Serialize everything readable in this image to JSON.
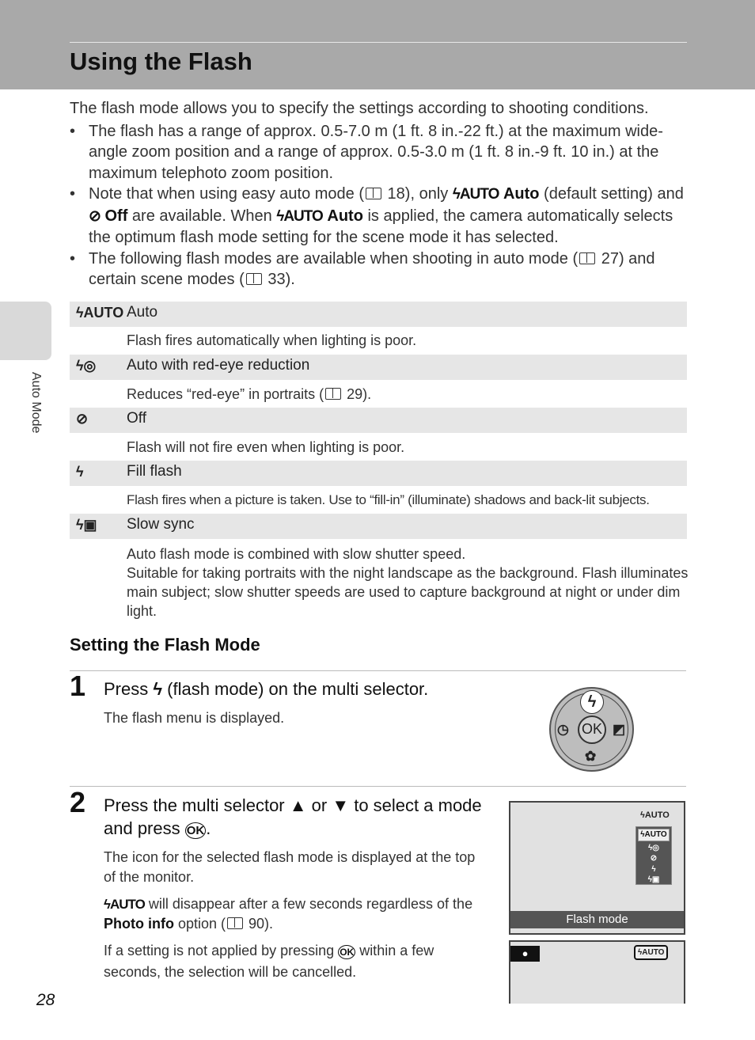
{
  "header": {
    "title": "Using the Flash"
  },
  "sidebar": {
    "section": "Auto Mode"
  },
  "intro": "The flash mode allows you to specify the settings according to shooting conditions.",
  "bullets": {
    "b1": "The flash has a range of approx. 0.5-7.0 m (1 ft. 8 in.-22 ft.) at the maximum wide-angle zoom position and a range of approx. 0.5-3.0 m (1 ft. 8 in.-9 ft. 10 in.) at the maximum telephoto zoom position.",
    "b2a": "Note that when using easy auto mode (",
    "b2b": " 18), only ",
    "b2auto": "Auto",
    "b2c": " (default setting) and ",
    "b2off": "Off",
    "b2d": " are available. When ",
    "b2e": " is applied, the camera automatically selects the optimum flash mode setting for the scene mode it has selected.",
    "b3a": "The following flash modes are available when shooting in auto mode (",
    "b3b": " 27) and certain scene modes (",
    "b3c": " 33)."
  },
  "icons": {
    "auto": "ϟAUTO",
    "redeye": "ϟ◎",
    "off": "⊘",
    "fill": "ϟ",
    "slow": "ϟ▣"
  },
  "modes": [
    {
      "label": "Auto",
      "desc": "Flash fires automatically when lighting is poor."
    },
    {
      "label": "Auto with red-eye reduction",
      "desc_a": "Reduces “red-eye” in portraits (",
      "desc_b": " 29)."
    },
    {
      "label": "Off",
      "desc": "Flash will not fire even when lighting is poor."
    },
    {
      "label": "Fill flash",
      "desc": "Flash fires when a picture is taken. Use to “fill-in” (illuminate) shadows and back-lit subjects."
    },
    {
      "label": "Slow sync",
      "desc": "Auto flash mode is combined with slow shutter speed.",
      "desc2": "Suitable for taking portraits with the night landscape as the background. Flash illuminates main subject; slow shutter speeds are used to capture background at night or under dim light."
    }
  ],
  "section": {
    "title": "Setting the Flash Mode"
  },
  "step1": {
    "num": "1",
    "title_a": "Press ",
    "title_b": " (flash mode) on the multi selector.",
    "text": "The flash menu is displayed."
  },
  "dial": {
    "ok": "OK",
    "up": "ϟ",
    "left": "◷",
    "right": "◩",
    "down": "✿"
  },
  "step2": {
    "num": "2",
    "title_a": "Press the multi selector ",
    "up": "▲",
    "or": " or ",
    "down": "▼",
    "title_b": " to select a mode and press ",
    "ok": "OK",
    "title_c": ".",
    "p1": "The icon for the selected flash mode is displayed at the top of the monitor.",
    "p2a": " will disappear after a few seconds regardless of the ",
    "p2b": "Photo info",
    "p2c": " option (",
    "p2d": " 90).",
    "p3a": "If a setting is not applied by pressing ",
    "p3b": " within a few seconds, the selection will be cancelled."
  },
  "screen": {
    "caption": "Flash mode",
    "camera": "●"
  },
  "page_number": "28"
}
